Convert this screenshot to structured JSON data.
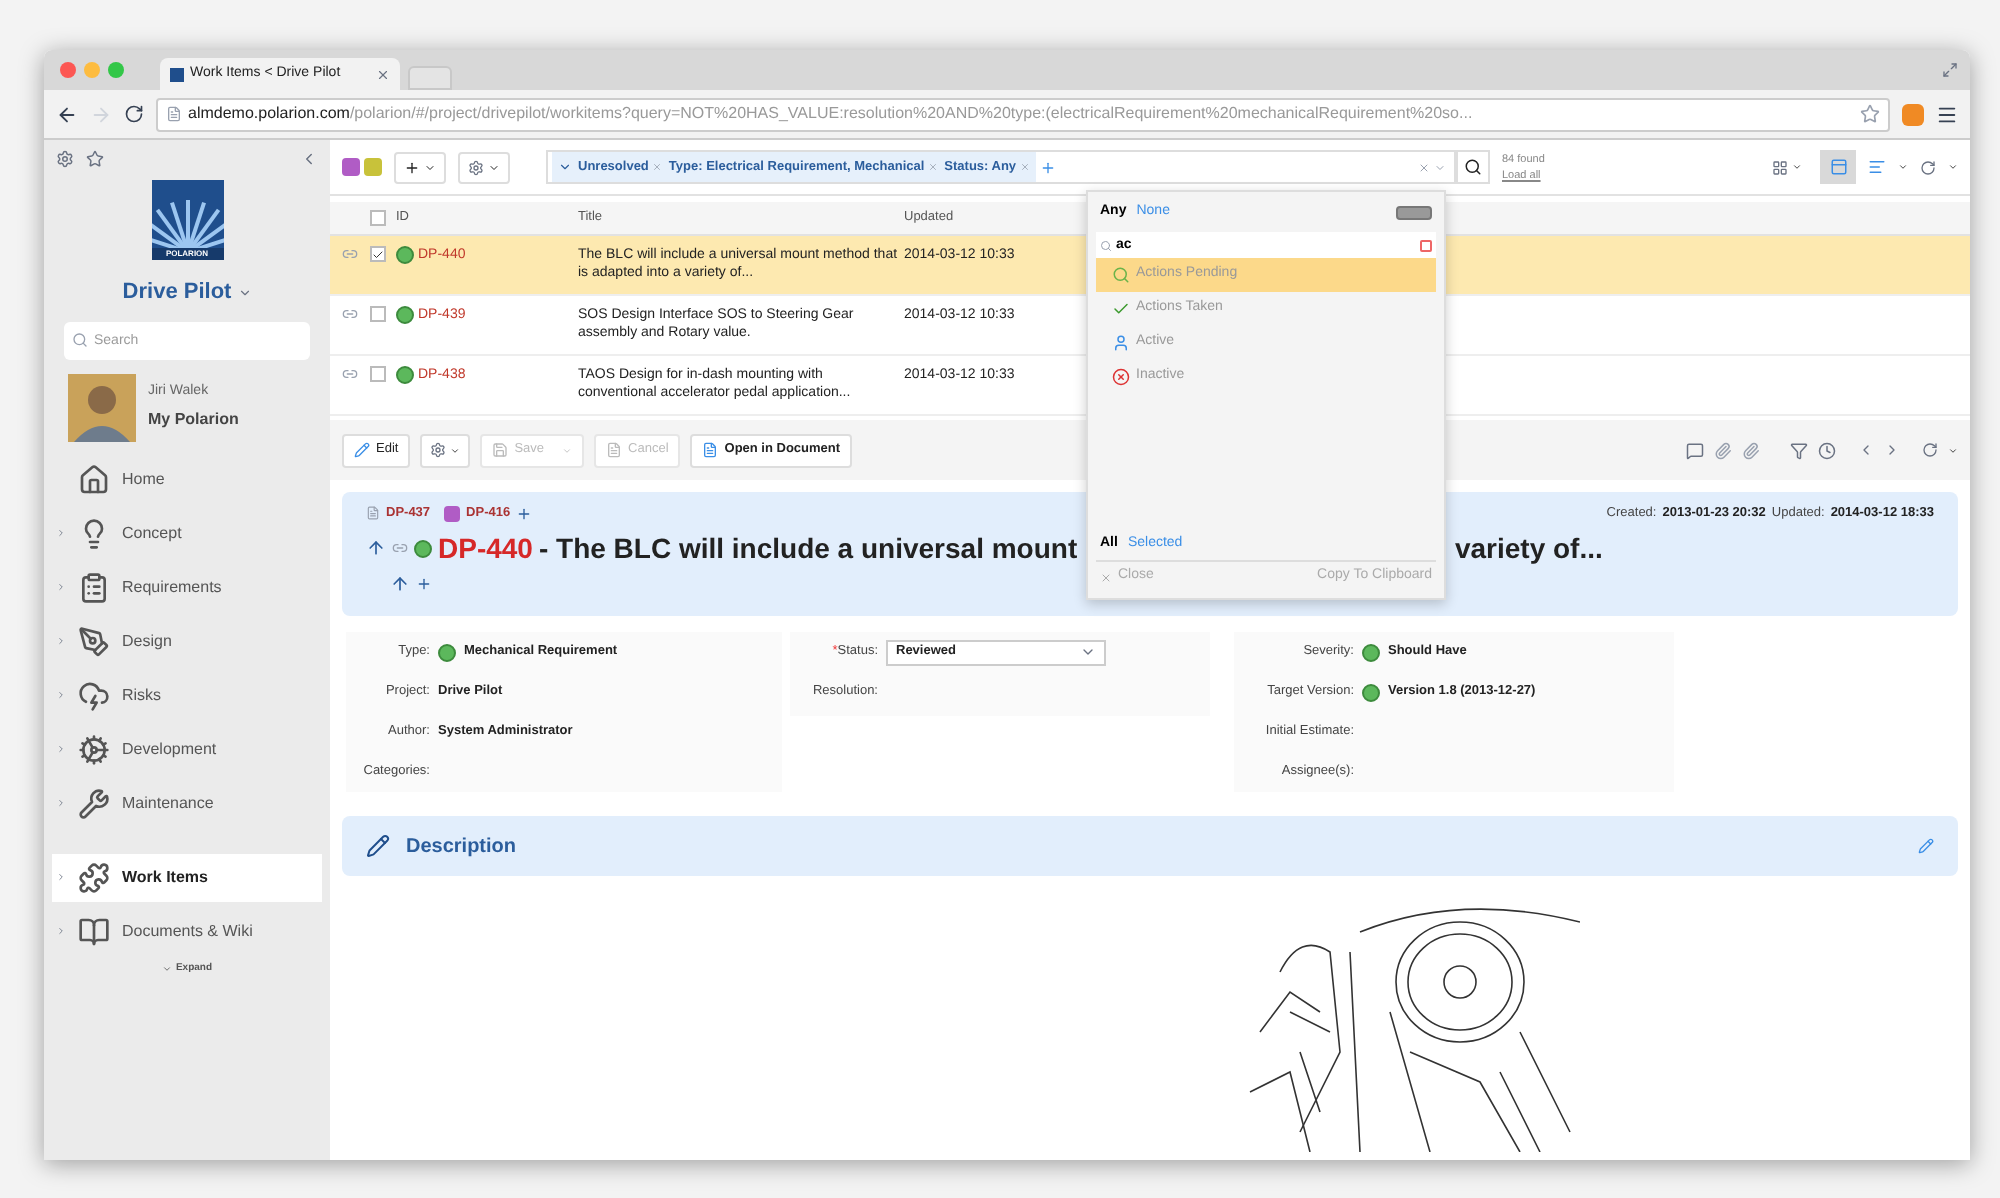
{
  "browser": {
    "tab_title": "Work Items < Drive Pilot",
    "url_host": "almdemo.polarion.com",
    "url_path": "/polarion/#/project/drivepilot/workitems?query=NOT%20HAS_VALUE:resolution%20AND%20type:(electricalRequirement%20mechanicalRequirement%20so..."
  },
  "sidebar": {
    "logo_text": "POLARION",
    "project": "Drive Pilot",
    "search": {
      "placeholder": "Search"
    },
    "user": {
      "name": "Jiri Walek",
      "link": "My Polarion"
    },
    "items": [
      {
        "label": "Home",
        "expandable": false,
        "selected": false
      },
      {
        "label": "Concept",
        "expandable": true,
        "selected": false
      },
      {
        "label": "Requirements",
        "expandable": true,
        "selected": false
      },
      {
        "label": "Design",
        "expandable": true,
        "selected": false
      },
      {
        "label": "Risks",
        "expandable": true,
        "selected": false
      },
      {
        "label": "Development",
        "expandable": true,
        "selected": false
      },
      {
        "label": "Maintenance",
        "expandable": true,
        "selected": false
      },
      {
        "label": "Work Items",
        "expandable": true,
        "selected": true
      },
      {
        "label": "Documents & Wiki",
        "expandable": true,
        "selected": false
      }
    ],
    "expand": "Expand"
  },
  "toolbar": {
    "filters": [
      {
        "label": "Unresolved"
      },
      {
        "label": "Type: Electrical Requirement, Mechanical"
      },
      {
        "label": "Status: Any"
      }
    ],
    "found": "84 found",
    "load_all": "Load all"
  },
  "table": {
    "columns": [
      "ID",
      "Title",
      "Updated"
    ],
    "all_checked": false,
    "rows": [
      {
        "id": "DP-440",
        "title": "The BLC will include a universal mount method that is adapted into a variety of...",
        "updated": "2014-03-12 10:33",
        "checked": true,
        "selected": true
      },
      {
        "id": "DP-439",
        "title": "SOS Design Interface SOS to Steering Gear assembly and Rotary value.",
        "updated": "2014-03-12 10:33",
        "checked": false,
        "selected": false
      },
      {
        "id": "DP-438",
        "title": "TAOS Design for in-dash mounting with conventional accelerator pedal application...",
        "updated": "2014-03-12 10:33",
        "checked": false,
        "selected": false
      }
    ]
  },
  "actions": {
    "edit": "Edit",
    "save": "Save",
    "cancel": "Cancel",
    "open": "Open in Document"
  },
  "detail": {
    "links": [
      "DP-437",
      "DP-416"
    ],
    "created_label": "Created:",
    "created": "2013-01-23 20:32",
    "updated_label": "Updated:",
    "updated": "2014-03-12 18:33",
    "id": "DP-440",
    "title_start": "- The BLC will include a universal mount",
    "title_end": "variety of...",
    "fields_left": [
      {
        "label": "Type:",
        "value": "Mechanical Requirement",
        "kind": "icon-text"
      },
      {
        "label": "Project:",
        "value": "Drive Pilot",
        "kind": "text"
      },
      {
        "label": "Author:",
        "value": "System Administrator",
        "kind": "text"
      },
      {
        "label": "Categories:",
        "kind": "empty"
      }
    ],
    "fields_middle": [
      {
        "label": "Status:",
        "marker": "*",
        "value": "Reviewed",
        "kind": "select"
      },
      {
        "label": "Resolution:",
        "kind": "empty"
      }
    ],
    "fields_right": [
      {
        "label": "Severity:",
        "value": "Should Have",
        "kind": "icon-text"
      },
      {
        "label": "Target Version:",
        "value": "**Version 1.8** (2013-12-27)",
        "kind": "icon-text"
      },
      {
        "label": "Initial Estimate:",
        "kind": "empty"
      },
      {
        "label": "Assignee(s):",
        "kind": "empty"
      }
    ],
    "description": "Description"
  },
  "status_dropdown": {
    "any": "Any",
    "none": "None",
    "query": "ac",
    "options": [
      {
        "label": "Actions Pending",
        "highlighted": true
      },
      {
        "label": "Actions Taken",
        "highlighted": false
      },
      {
        "label": "Active",
        "highlighted": false
      },
      {
        "label": "Inactive",
        "highlighted": false
      }
    ],
    "all": "All",
    "selected": "Selected",
    "close": "Close",
    "copy": "Copy To Clipboard"
  }
}
